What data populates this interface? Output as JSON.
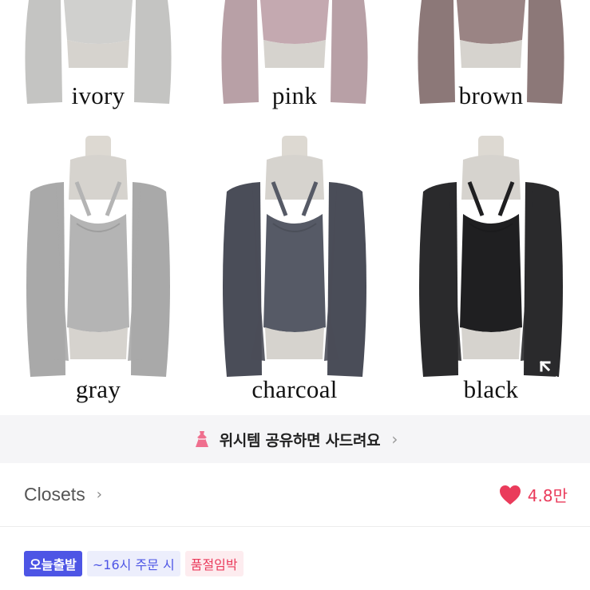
{
  "gallery": {
    "colors": [
      {
        "label": "ivory",
        "tone": "#c4c4c2",
        "top": "#d0d0ce"
      },
      {
        "label": "pink",
        "tone": "#b8a0a6",
        "top": "#c4a9b0"
      },
      {
        "label": "brown",
        "tone": "#8c7878",
        "top": "#9a8484"
      },
      {
        "label": "gray",
        "tone": "#a9a9a9",
        "top": "#b4b4b4"
      },
      {
        "label": "charcoal",
        "tone": "#4a4d58",
        "top": "#565a66"
      },
      {
        "label": "black",
        "tone": "#2a2a2c",
        "top": "#1f1f21"
      }
    ],
    "expand_icon": "expand-icon"
  },
  "share_banner": {
    "icon": "dress-icon",
    "text": "위시템 공유하면 사드려요",
    "chevron": "›"
  },
  "closets": {
    "label": "Closets",
    "chevron": "›",
    "like_icon": "heart-icon",
    "like_count": "4.8만",
    "like_color": "#ea3b5b"
  },
  "tags": {
    "today": "오늘출발",
    "cutoff": "~16시 주문 시",
    "soldout": "품절임박"
  },
  "colors": {
    "accent_blue": "#4d55e5",
    "accent_pink": "#ea3b5b"
  }
}
